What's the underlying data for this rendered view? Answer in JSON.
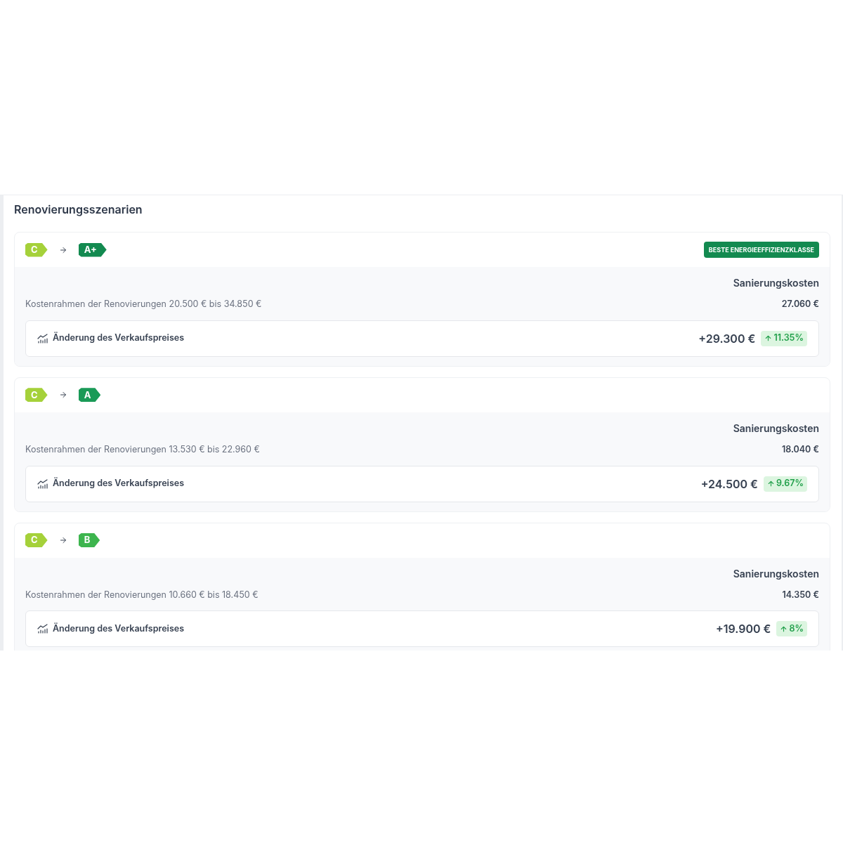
{
  "section": {
    "title": "Renovierungsszenarien"
  },
  "scenarios": [
    {
      "from": {
        "label": "C",
        "color": "#a5d13a"
      },
      "to": {
        "label": "A+",
        "color": "#138a50"
      },
      "best_badge": "BESTE ENERGIEEFFIZIENZKLASSE",
      "cost_label": "Sanierungskosten",
      "range": "Kostenrahmen der Renovierungen 20.500 € bis 34.850 €",
      "cost": "27.060 €",
      "change_label": "Änderung des Verkaufspreises",
      "change_value": "+29.300 €",
      "change_percent": "11.35%"
    },
    {
      "from": {
        "label": "C",
        "color": "#a5d13a"
      },
      "to": {
        "label": "A",
        "color": "#1a9a57"
      },
      "cost_label": "Sanierungskosten",
      "range": "Kostenrahmen der Renovierungen 13.530 € bis 22.960 €",
      "cost": "18.040 €",
      "change_label": "Änderung des Verkaufspreises",
      "change_value": "+24.500 €",
      "change_percent": "9.67%"
    },
    {
      "from": {
        "label": "C",
        "color": "#a5d13a"
      },
      "to": {
        "label": "B",
        "color": "#3db54e"
      },
      "cost_label": "Sanierungskosten",
      "range": "Kostenrahmen der Renovierungen 10.660 € bis 18.450 €",
      "cost": "14.350 €",
      "change_label": "Änderung des Verkaufspreises",
      "change_value": "+19.900 €",
      "change_percent": "8%"
    }
  ]
}
